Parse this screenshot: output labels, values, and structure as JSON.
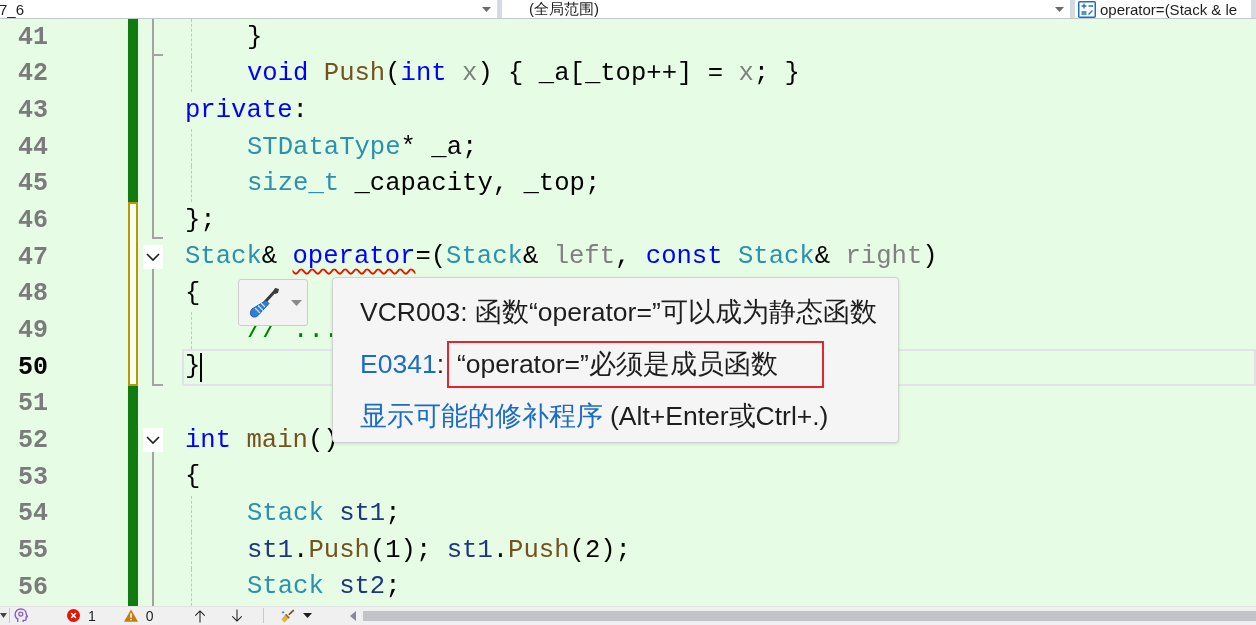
{
  "navigation_bar": {
    "project": "7_6",
    "scope": "(全局范围)",
    "member": "operator=(Stack & le"
  },
  "editor": {
    "lines": [
      {
        "number": "41",
        "saved": true,
        "outline": {
          "kind": "end"
        },
        "indented": true,
        "current": false,
        "tokens": [
          {
            "text": "}",
            "kind": "plain",
            "error": false
          }
        ]
      },
      {
        "number": "42",
        "saved": true,
        "outline": {
          "kind": "line"
        },
        "indented": true,
        "current": false,
        "tokens": [
          {
            "text": "void ",
            "kind": "keyword",
            "error": false
          },
          {
            "text": "Push",
            "kind": "function",
            "error": false
          },
          {
            "text": "(",
            "kind": "plain",
            "error": false
          },
          {
            "text": "int ",
            "kind": "keyword",
            "error": false
          },
          {
            "text": "x",
            "kind": "param",
            "error": false
          },
          {
            "text": ") { _a[_top++] = ",
            "kind": "plain",
            "error": false
          },
          {
            "text": "x",
            "kind": "param",
            "error": false
          },
          {
            "text": "; }",
            "kind": "plain",
            "error": false
          }
        ]
      },
      {
        "number": "43",
        "saved": true,
        "outline": {
          "kind": "line"
        },
        "indented": false,
        "current": false,
        "tokens": [
          {
            "text": "private",
            "kind": "keyword",
            "error": false
          },
          {
            "text": ":",
            "kind": "plain",
            "error": false
          }
        ]
      },
      {
        "number": "44",
        "saved": true,
        "outline": {
          "kind": "line"
        },
        "indented": true,
        "current": false,
        "tokens": [
          {
            "text": "STDataType",
            "kind": "type",
            "error": false
          },
          {
            "text": "* _a;",
            "kind": "plain",
            "error": false
          }
        ]
      },
      {
        "number": "45",
        "saved": true,
        "outline": {
          "kind": "line"
        },
        "indented": true,
        "current": false,
        "tokens": [
          {
            "text": "size_t",
            "kind": "type",
            "error": false
          },
          {
            "text": " _capacity, _top;",
            "kind": "plain",
            "error": false
          }
        ]
      },
      {
        "number": "46",
        "saved": false,
        "outline": {
          "kind": "end"
        },
        "indented": false,
        "current": false,
        "tokens": [
          {
            "text": "};",
            "kind": "plain",
            "error": false
          }
        ]
      },
      {
        "number": "47",
        "saved": false,
        "outline": {
          "kind": "fold",
          "expanded": true
        },
        "indented": false,
        "current": false,
        "tokens": [
          {
            "text": "Stack",
            "kind": "type",
            "error": false
          },
          {
            "text": "& ",
            "kind": "plain",
            "error": false
          },
          {
            "text": "operator",
            "kind": "keyword",
            "error": true
          },
          {
            "text": "=(",
            "kind": "plain",
            "error": false
          },
          {
            "text": "Stack",
            "kind": "type",
            "error": false
          },
          {
            "text": "& ",
            "kind": "plain",
            "error": false
          },
          {
            "text": "left",
            "kind": "param",
            "error": false
          },
          {
            "text": ", ",
            "kind": "plain",
            "error": false
          },
          {
            "text": "const ",
            "kind": "keyword",
            "error": false
          },
          {
            "text": "Stack",
            "kind": "type",
            "error": false
          },
          {
            "text": "& ",
            "kind": "plain",
            "error": false
          },
          {
            "text": "right",
            "kind": "param",
            "error": false
          },
          {
            "text": ")",
            "kind": "plain",
            "error": false
          }
        ]
      },
      {
        "number": "48",
        "saved": false,
        "outline": {
          "kind": "line"
        },
        "indented": false,
        "current": false,
        "tokens": [
          {
            "text": "{",
            "kind": "plain",
            "error": false
          }
        ]
      },
      {
        "number": "49",
        "saved": false,
        "outline": {
          "kind": "line"
        },
        "indented": true,
        "current": false,
        "tokens": [
          {
            "text": "// ...",
            "kind": "comment",
            "error": false
          }
        ]
      },
      {
        "number": "50",
        "saved": false,
        "outline": {
          "kind": "end"
        },
        "indented": false,
        "current": true,
        "tokens": [
          {
            "text": "}",
            "kind": "plain",
            "error": false
          }
        ]
      },
      {
        "number": "51",
        "saved": true,
        "outline": {
          "kind": "none"
        },
        "indented": false,
        "current": false
      },
      {
        "number": "52",
        "saved": true,
        "outline": {
          "kind": "fold",
          "expanded": true
        },
        "indented": false,
        "current": false,
        "tokens": [
          {
            "text": "int ",
            "kind": "keyword",
            "error": false
          },
          {
            "text": "main",
            "kind": "function",
            "error": false
          },
          {
            "text": "()",
            "kind": "plain",
            "error": false
          }
        ]
      },
      {
        "number": "53",
        "saved": true,
        "outline": {
          "kind": "line"
        },
        "indented": false,
        "current": false,
        "tokens": [
          {
            "text": "{",
            "kind": "plain",
            "error": false
          }
        ]
      },
      {
        "number": "54",
        "saved": true,
        "outline": {
          "kind": "line"
        },
        "indented": true,
        "current": false,
        "tokens": [
          {
            "text": "Stack ",
            "kind": "type",
            "error": false
          },
          {
            "text": "st1",
            "kind": "local",
            "error": false
          },
          {
            "text": ";",
            "kind": "plain",
            "error": false
          }
        ]
      },
      {
        "number": "55",
        "saved": true,
        "outline": {
          "kind": "line"
        },
        "indented": true,
        "current": false,
        "tokens": [
          {
            "text": "st1",
            "kind": "local",
            "error": false
          },
          {
            "text": ".",
            "kind": "plain",
            "error": false
          },
          {
            "text": "Push",
            "kind": "function",
            "error": false
          },
          {
            "text": "(1); ",
            "kind": "plain",
            "error": false
          },
          {
            "text": "st1",
            "kind": "local",
            "error": false
          },
          {
            "text": ".",
            "kind": "plain",
            "error": false
          },
          {
            "text": "Push",
            "kind": "function",
            "error": false
          },
          {
            "text": "(2);",
            "kind": "plain",
            "error": false
          }
        ]
      },
      {
        "number": "56",
        "saved": true,
        "outline": {
          "kind": "line"
        },
        "indented": true,
        "current": false,
        "tokens": [
          {
            "text": "Stack ",
            "kind": "type",
            "error": false
          },
          {
            "text": "st2",
            "kind": "local",
            "error": false
          },
          {
            "text": ";",
            "kind": "plain",
            "error": false
          }
        ]
      }
    ]
  },
  "popup": {
    "diagnostics": [
      {
        "kind": "text",
        "text": "VCR003: 函数“operator=”可以成为静态函数",
        "highlighted": false
      },
      {
        "kind": "error",
        "code": "E0341",
        "separator": ":",
        "text": "“operator=”必须是成员函数",
        "highlighted": true
      }
    ],
    "fix": {
      "link": "显示可能的修补程序",
      "shortcut": "(Alt+Enter或Ctrl+.)"
    }
  },
  "status_bar": {
    "errors": "1",
    "warnings": "0"
  }
}
